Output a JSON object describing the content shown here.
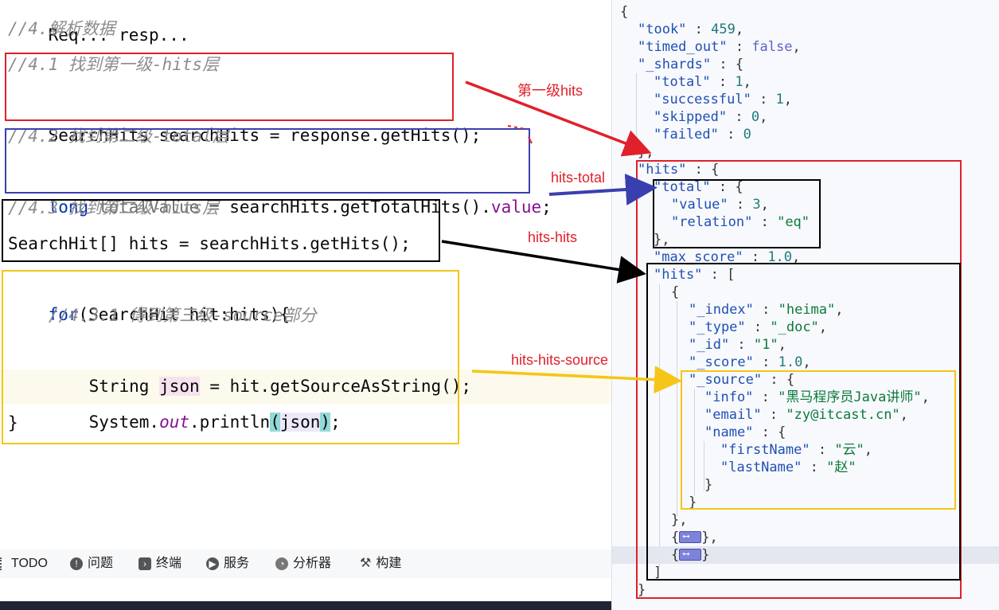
{
  "editor": {
    "lines": {
      "partial_top": "Req... resp...",
      "c4": "//4.解析数据",
      "c41": "//4.1 找到第一级-hits层",
      "l41_type": "SearchHits",
      "l41_var": "searchHits",
      "l41_rest": "= response.getHits();",
      "c42": "//4.2 找到第二级-total层",
      "l42_kw": "long",
      "l42_var": "totalValue",
      "l42_mid": "= searchHits.getTotalHits().",
      "l42_field": "value",
      "l42_end": ";",
      "c43": "//4.3 找到第二级-hits层",
      "l43": "SearchHit[] hits = searchHits.getHits();",
      "for_kw": "for",
      "for_rest": "(SearchHit hit:hits){",
      "c431": "//4.3.1 得到第三级-source部分",
      "l431_a": "String ",
      "l431_json": "json",
      "l431_b": " = hit.getSourceAsString();",
      "print_a": "System.",
      "print_out": "out",
      "print_b": ".println",
      "print_lp": "(",
      "print_json": "json",
      "print_rp": ")",
      "print_end": ";",
      "close": "}"
    }
  },
  "toolbar": {
    "items": [
      {
        "label": "TODO",
        "icon": "list-icon"
      },
      {
        "label": "问题",
        "icon": "alert-icon"
      },
      {
        "label": "终端",
        "icon": "terminal-icon"
      },
      {
        "label": "服务",
        "icon": "play-icon"
      },
      {
        "label": "分析器",
        "icon": "profiler-icon"
      },
      {
        "label": "构建",
        "icon": "hammer-icon"
      }
    ]
  },
  "json_view": {
    "took_key": "\"took\"",
    "took_val": "459",
    "timed_out_key": "\"timed_out\"",
    "timed_out_val": "false",
    "shards_key": "\"_shards\"",
    "total_key": "\"total\"",
    "total_val": "1",
    "successful_key": "\"successful\"",
    "successful_val": "1",
    "skipped_key": "\"skipped\"",
    "skipped_val": "0",
    "failed_key": "\"failed\"",
    "failed_val": "0",
    "hits_key": "\"hits\"",
    "value_key": "\"value\"",
    "value_val": "3",
    "relation_key": "\"relation\"",
    "relation_val": "\"eq\"",
    "max_score_key": "\"max_score\"",
    "max_score_val": "1.0",
    "index_key": "\"_index\"",
    "index_val": "\"heima\"",
    "type_key": "\"_type\"",
    "type_val": "\"_doc\"",
    "id_key": "\"_id\"",
    "id_val": "\"1\"",
    "score_key": "\"_score\"",
    "score_val": "1.0",
    "source_key": "\"_source\"",
    "info_key": "\"info\"",
    "info_val": "\"黑马程序员Java讲师\"",
    "email_key": "\"email\"",
    "email_val": "\"zy@itcast.cn\"",
    "name_key": "\"name\"",
    "first_key": "\"firstName\"",
    "first_val": "\"云\"",
    "last_key": "\"lastName\"",
    "last_val": "\"赵\""
  },
  "annotations": {
    "first_hits": "第一级hits",
    "hits_total": "hits-total",
    "hits_hits": "hits-hits",
    "hits_hits_source": "hits-hits-source"
  },
  "colors": {
    "red": "#e0202a",
    "blue": "#3a3fb0",
    "black": "#000000",
    "yellow": "#f5c518"
  }
}
